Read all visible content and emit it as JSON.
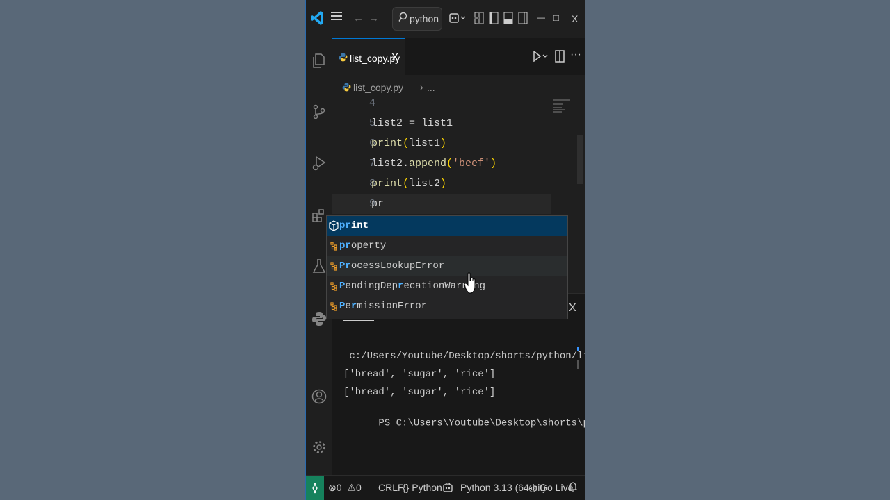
{
  "titlebar": {
    "search_text": "python",
    "menu_icon": "hamburger-icon",
    "back_icon": "arrow-left-icon",
    "forward_icon": "arrow-right-icon",
    "minimize": "—",
    "maximize": "□",
    "close": "X"
  },
  "tabs": [
    {
      "label": "list_copy.py",
      "close": "X",
      "active": true
    }
  ],
  "breadcrumb": {
    "file": "list_copy.py",
    "sep": "›",
    "more": "..."
  },
  "editor": {
    "lines": [
      {
        "num": "4",
        "text": ""
      },
      {
        "num": "5",
        "text": "list2 = list1"
      },
      {
        "num": "6",
        "text": "print(list1)"
      },
      {
        "num": "7",
        "text": "list2.append('beef')"
      },
      {
        "num": "8",
        "text": "print(list2)"
      },
      {
        "num": "9",
        "text": "pr"
      }
    ]
  },
  "suggestions": [
    {
      "label": "print",
      "icon": "method-cube-icon",
      "state": "selected"
    },
    {
      "label": "property",
      "icon": "class-icon",
      "state": "normal"
    },
    {
      "label": "ProcessLookupError",
      "icon": "class-icon",
      "state": "hover"
    },
    {
      "label": "PendingDeprecationWarning",
      "icon": "class-icon",
      "state": "normal"
    },
    {
      "label": "PermissionError",
      "icon": "class-icon",
      "state": "normal"
    }
  ],
  "terminal": {
    "lines": [
      " c:/Users/Youtube/Desktop/shorts/python/list_copy.py",
      "['bread', 'sugar', 'rice']",
      "['bread', 'sugar', 'rice']",
      "PS C:\\Users\\Youtube\\Desktop\\shorts\\python>"
    ],
    "close": "X"
  },
  "statusbar": {
    "remote": "⌵",
    "errors": "0",
    "warnings": "0",
    "eol": "CRLF",
    "language": "Python",
    "interpreter": "Python 3.13 (64-bit)",
    "golive": "Go Live"
  },
  "colors": {
    "background": "#596878",
    "window": "#1f1f1f",
    "accent": "#0078d4",
    "remote": "#16825d",
    "selected": "#04395e"
  }
}
